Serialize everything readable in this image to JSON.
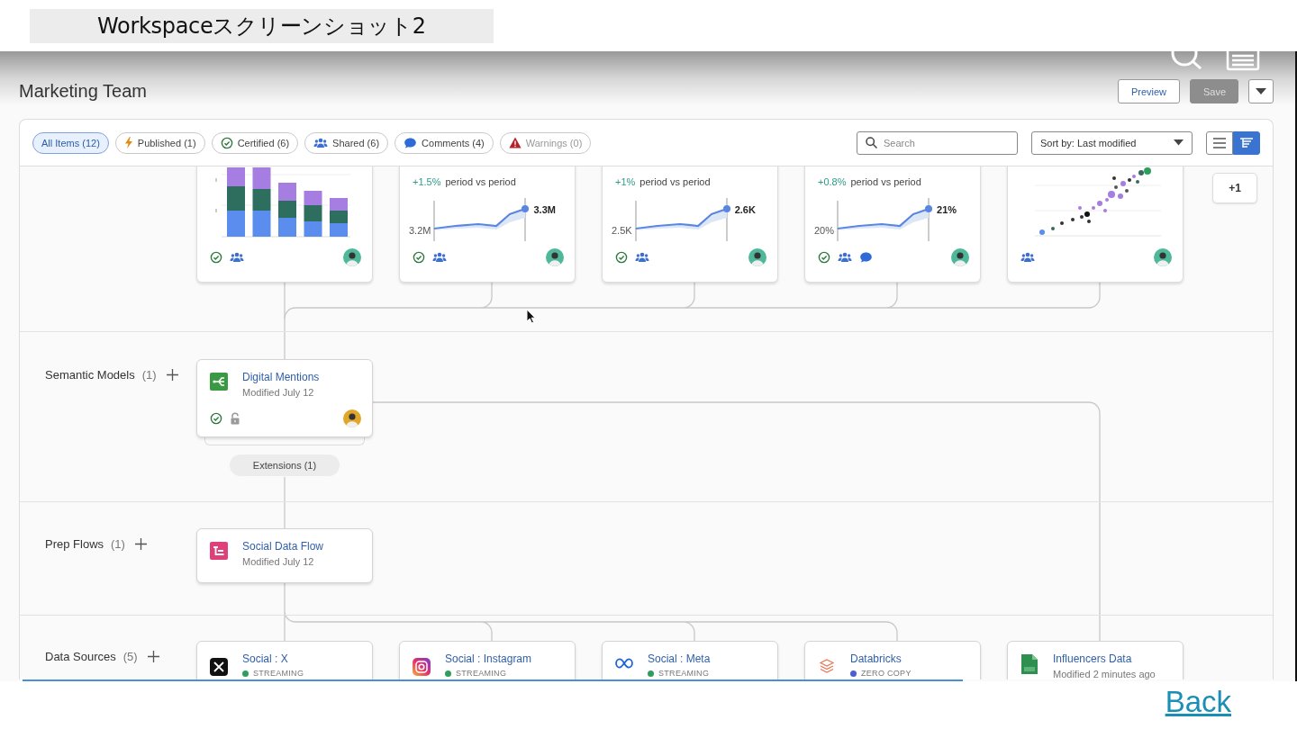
{
  "caption": "Workspaceスクリーンショット2",
  "header": {
    "title": "Marketing Team",
    "buttons": [
      {
        "label": "Preview",
        "disabled": false
      },
      {
        "label": "Save",
        "disabled": true
      }
    ]
  },
  "filters": [
    {
      "label": "All Items (12)",
      "kind": "all",
      "selected": true,
      "disabled": false
    },
    {
      "label": "Published (1)",
      "kind": "published",
      "selected": false,
      "disabled": false
    },
    {
      "label": "Certified (6)",
      "kind": "certified",
      "selected": false,
      "disabled": false
    },
    {
      "label": "Shared (6)",
      "kind": "shared",
      "selected": false,
      "disabled": false
    },
    {
      "label": "Comments (4)",
      "kind": "comments",
      "selected": false,
      "disabled": false
    },
    {
      "label": "Warnings (0)",
      "kind": "warnings",
      "selected": false,
      "disabled": true
    }
  ],
  "search": {
    "placeholder": "Search"
  },
  "sort": {
    "value": "Sort by: Last modified"
  },
  "view_toggle": [
    {
      "kind": "list",
      "selected": false
    },
    {
      "kind": "lineage",
      "selected": true
    }
  ],
  "top_cards": [
    {
      "kind": "bar",
      "certified": true,
      "shared": true,
      "avatar": true
    },
    {
      "kind": "kpi",
      "change": "+1.5%",
      "caption": "period vs period",
      "start": "3.2M",
      "end": "3.3M",
      "certified": true,
      "shared": true,
      "avatar": true
    },
    {
      "kind": "kpi",
      "change": "+1%",
      "caption": "period vs period",
      "start": "2.5K",
      "end": "2.6K",
      "certified": true,
      "shared": true,
      "avatar": true
    },
    {
      "kind": "kpi",
      "change": "+0.8%",
      "caption": "period vs period",
      "start": "20%",
      "end": "21%",
      "certified": true,
      "shared": true,
      "commented": true,
      "avatar": true
    },
    {
      "kind": "scatter",
      "shared": true,
      "avatar": true
    }
  ],
  "more_button": "+1",
  "lanes": [
    {
      "label": "Semantic Models",
      "count": "(1)",
      "items": [
        {
          "kind": "semantic_model",
          "title": "Digital Mentions",
          "subtitle": "Modified July 12",
          "certified": true,
          "locked": true,
          "avatar": true
        }
      ],
      "extensions": "Extensions (1)"
    },
    {
      "label": "Prep Flows",
      "count": "(1)",
      "items": [
        {
          "kind": "prep_flow",
          "title": "Social Data Flow",
          "subtitle": "Modified July 12"
        }
      ]
    },
    {
      "label": "Data Sources",
      "count": "(5)",
      "items": [
        {
          "kind": "x",
          "title": "Social : X",
          "status": {
            "text": "STREAMING",
            "color": "#2f9e5c"
          }
        },
        {
          "kind": "instagram",
          "title": "Social : Instagram",
          "status": {
            "text": "STREAMING",
            "color": "#2f9e5c"
          }
        },
        {
          "kind": "meta",
          "title": "Social : Meta",
          "status": {
            "text": "STREAMING",
            "color": "#2f9e5c"
          }
        },
        {
          "kind": "databricks",
          "title": "Databricks",
          "status": {
            "text": "ZERO COPY",
            "color": "#4a5fd0"
          }
        },
        {
          "kind": "excel",
          "title": "Influencers Data",
          "subtitle": "Modified 2 minutes ago"
        }
      ]
    }
  ],
  "video_progress": {
    "level": 0.74
  },
  "back_link": "Back"
}
